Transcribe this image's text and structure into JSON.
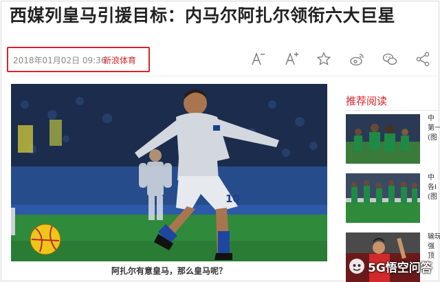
{
  "article": {
    "title": "西媒列皇马引援目标：内马尔阿扎尔领衔六大巨星",
    "date": "2018年01月02日 09:36",
    "source": "新浪体育",
    "image_caption": "阿扎尔有意皇马，那么皇马呢？"
  },
  "toolbar": {
    "icons": [
      "font-decrease-icon",
      "font-increase-icon",
      "favorite-star-icon",
      "weibo-share-icon",
      "wechat-share-icon",
      "share-icon"
    ]
  },
  "sidebar": {
    "heading": "推荐阅读",
    "items": [
      {
        "lines": [
          "中",
          "第一",
          "(图"
        ]
      },
      {
        "lines": [
          "中",
          "各I",
          "(图"
        ]
      },
      {
        "lines": [
          "输玩",
          "强",
          "顶"
        ]
      }
    ]
  },
  "watermark": {
    "text": "5G悟空问答"
  },
  "colors": {
    "accent": "#d8232a",
    "meta_text": "#888888",
    "title_text": "#222222"
  }
}
